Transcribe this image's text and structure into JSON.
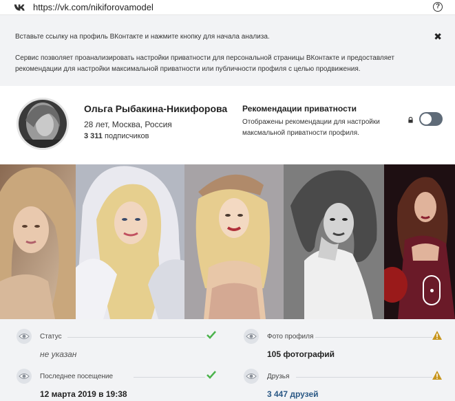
{
  "address_bar": {
    "url": "https://vk.com/nikiforovamodel"
  },
  "banner": {
    "instruction": "Вставьте ссылку на профиль ВКонтакте и нажмите кнопку для начала анализа.",
    "description": "Сервис позволяет проанализировать настройки приватности для персональной страницы ВКонтакте и предоставляет рекомендации для настройки максимальной приватности или публичности профиля с целью продвижения."
  },
  "profile": {
    "name": "Ольга Рыбакина-Никифорова",
    "meta": "28 лет, Москва, Россия",
    "subscribers_count": "3 311",
    "subscribers_label": "подписчиков"
  },
  "recommendations": {
    "title": "Рекомендации приватности",
    "description": "Отображены рекомендации для настройки максмальной приватности профиля.",
    "toggle_on": false
  },
  "stats": [
    {
      "label": "Статус",
      "value": "не указан",
      "state": "ok"
    },
    {
      "label": "Фото профиля",
      "value": "105 фотографий",
      "state": "warning"
    },
    {
      "label": "Последнее посещение",
      "value": "12 марта 2019 в 19:38",
      "state": "ok"
    },
    {
      "label": "Друзья",
      "value": "3 447 друзей",
      "state": "warning"
    }
  ],
  "colors": {
    "ok": "#4bb34b",
    "warning": "#c8961e",
    "link": "#2a5885"
  }
}
